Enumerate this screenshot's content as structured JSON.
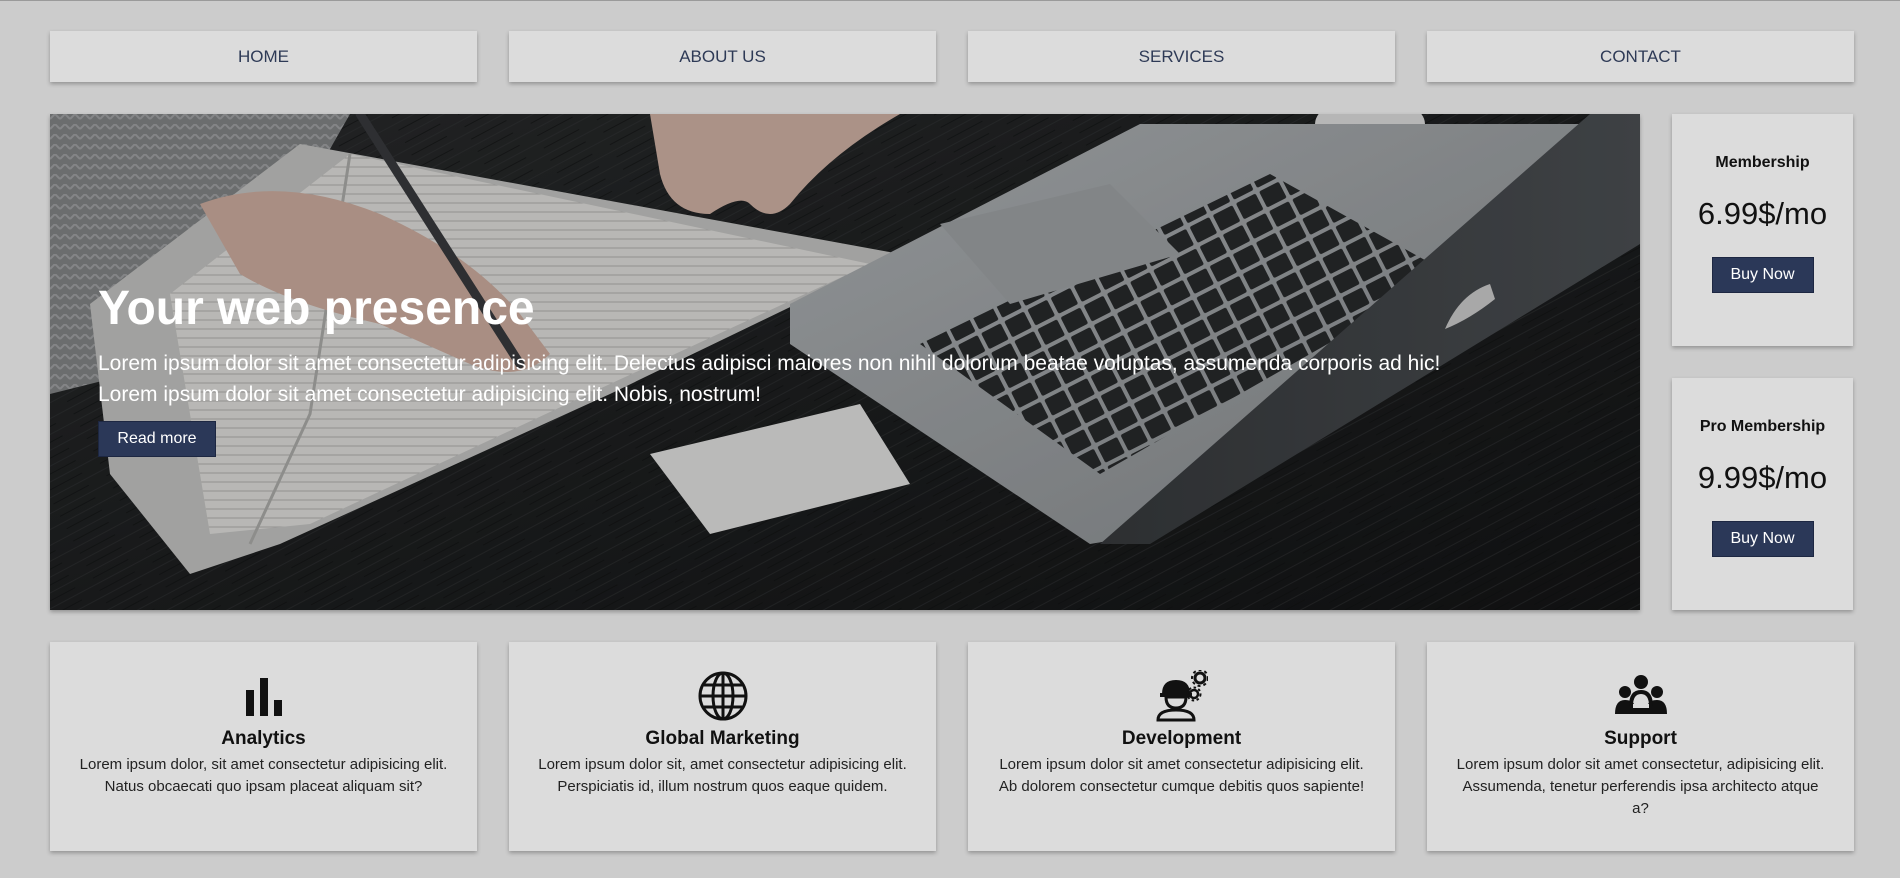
{
  "nav": {
    "items": [
      {
        "label": "HOME"
      },
      {
        "label": "ABOUT US"
      },
      {
        "label": "SERVICES"
      },
      {
        "label": "CONTACT"
      }
    ]
  },
  "hero": {
    "title": "Your web presence",
    "line1": "Lorem ipsum dolor sit amet consectetur adipisicing elit. Delectus adipisci maiores non nihil dolorum beatae voluptas, assumenda corporis ad hic!",
    "line2": "Lorem ipsum dolor sit amet consectetur adipisicing elit. Nobis, nostrum!",
    "button": "Read more"
  },
  "pricing": [
    {
      "name": "Membership",
      "price": "6.99$/mo",
      "button": "Buy Now"
    },
    {
      "name": "Pro Membership",
      "price": "9.99$/mo",
      "button": "Buy Now"
    }
  ],
  "features": [
    {
      "icon": "bar-chart-icon",
      "title": "Analytics",
      "text": "Lorem ipsum dolor, sit amet consectetur adipisicing elit. Natus obcaecati quo ipsam placeat aliquam sit?"
    },
    {
      "icon": "globe-icon",
      "title": "Global Marketing",
      "text": "Lorem ipsum dolor sit, amet consectetur adipisicing elit. Perspiciatis id, illum nostrum quos eaque quidem."
    },
    {
      "icon": "engineer-gears-icon",
      "title": "Development",
      "text": "Lorem ipsum dolor sit amet consectetur adipisicing elit. Ab dolorem consectetur cumque debitis quos sapiente!"
    },
    {
      "icon": "people-group-icon",
      "title": "Support",
      "text": "Lorem ipsum dolor sit amet consectetur, adipisicing elit. Assumenda, tenetur perferendis ipsa architecto atque a?"
    }
  ],
  "colors": {
    "page_bg": "#cccccc",
    "panel_bg": "#dcdcdc",
    "button_bg": "#2b3858",
    "nav_text": "#2e3a56"
  }
}
